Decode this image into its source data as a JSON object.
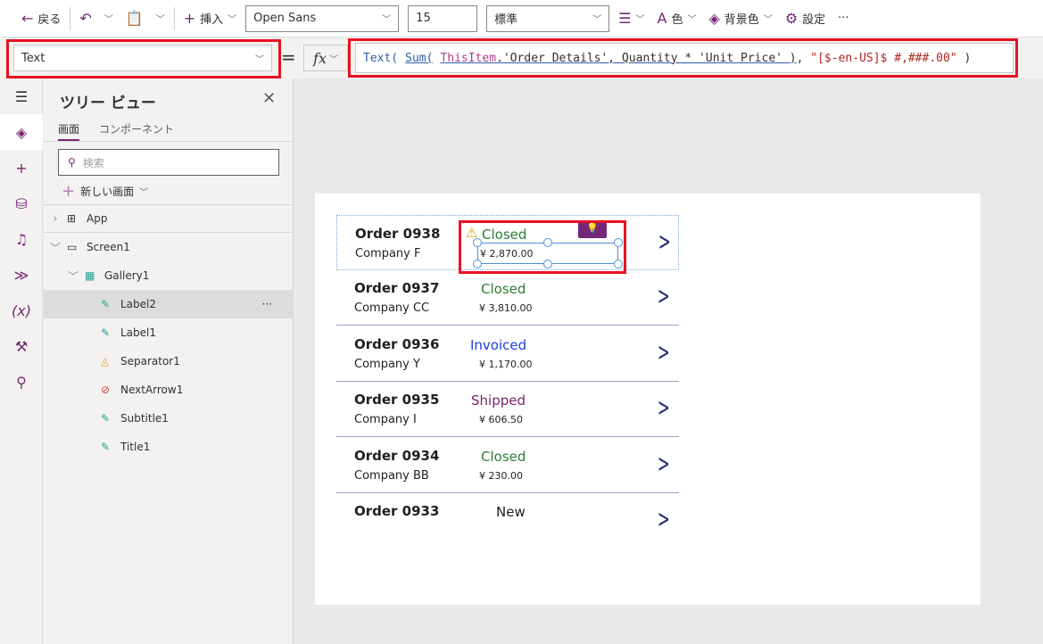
{
  "toolbar": {
    "back": "戻る",
    "insert": "挿入",
    "font": "Open Sans",
    "size": "15",
    "weight": "標準",
    "color": "色",
    "background": "背景色",
    "settings": "設定",
    "more": "···"
  },
  "formula": {
    "property": "Text",
    "equals": "=",
    "fx": "fx",
    "parts": [
      "Text(",
      "Sum(",
      "ThisItem",
      ".'Order Details', Quantity * 'Unit Price' )",
      ", ",
      "\"[$-en-US]$ #,###.00\"",
      " )"
    ]
  },
  "tree": {
    "title": "ツリー ビュー",
    "tabs": [
      "画面",
      "コンポーネント"
    ],
    "search_placeholder": "検索",
    "new_screen": "新しい画面",
    "nodes": [
      {
        "label": "App",
        "icon": "app-icon"
      },
      {
        "label": "Screen1",
        "icon": "screen-icon"
      },
      {
        "label": "Gallery1",
        "icon": "gallery-icon"
      },
      {
        "label": "Label2",
        "icon": "label-icon",
        "selected": true
      },
      {
        "label": "Label1",
        "icon": "label-icon"
      },
      {
        "label": "Separator1",
        "icon": "shapes-icon"
      },
      {
        "label": "NextArrow1",
        "icon": "icons-icon"
      },
      {
        "label": "Subtitle1",
        "icon": "label-icon"
      },
      {
        "label": "Title1",
        "icon": "label-icon"
      }
    ],
    "more": "···"
  },
  "gallery": [
    {
      "title": "Order 0938",
      "company": "Company F",
      "status": "Closed",
      "amount": "¥ 2,870.00",
      "color": "#2e7d32"
    },
    {
      "title": "Order 0937",
      "company": "Company CC",
      "status": "Closed",
      "amount": "¥ 3,810.00",
      "color": "#2e7d32"
    },
    {
      "title": "Order 0936",
      "company": "Company Y",
      "status": "Invoiced",
      "amount": "¥ 1,170.00",
      "color": "#1a3fe0"
    },
    {
      "title": "Order 0935",
      "company": "Company I",
      "status": "Shipped",
      "amount": "¥ 606.50",
      "color": "#7a1f6a"
    },
    {
      "title": "Order 0934",
      "company": "Company BB",
      "status": "Closed",
      "amount": "¥ 230.00",
      "color": "#2e7d32"
    },
    {
      "title": "Order 0933",
      "company": "",
      "status": "New",
      "amount": "",
      "color": "#201f1e"
    }
  ]
}
